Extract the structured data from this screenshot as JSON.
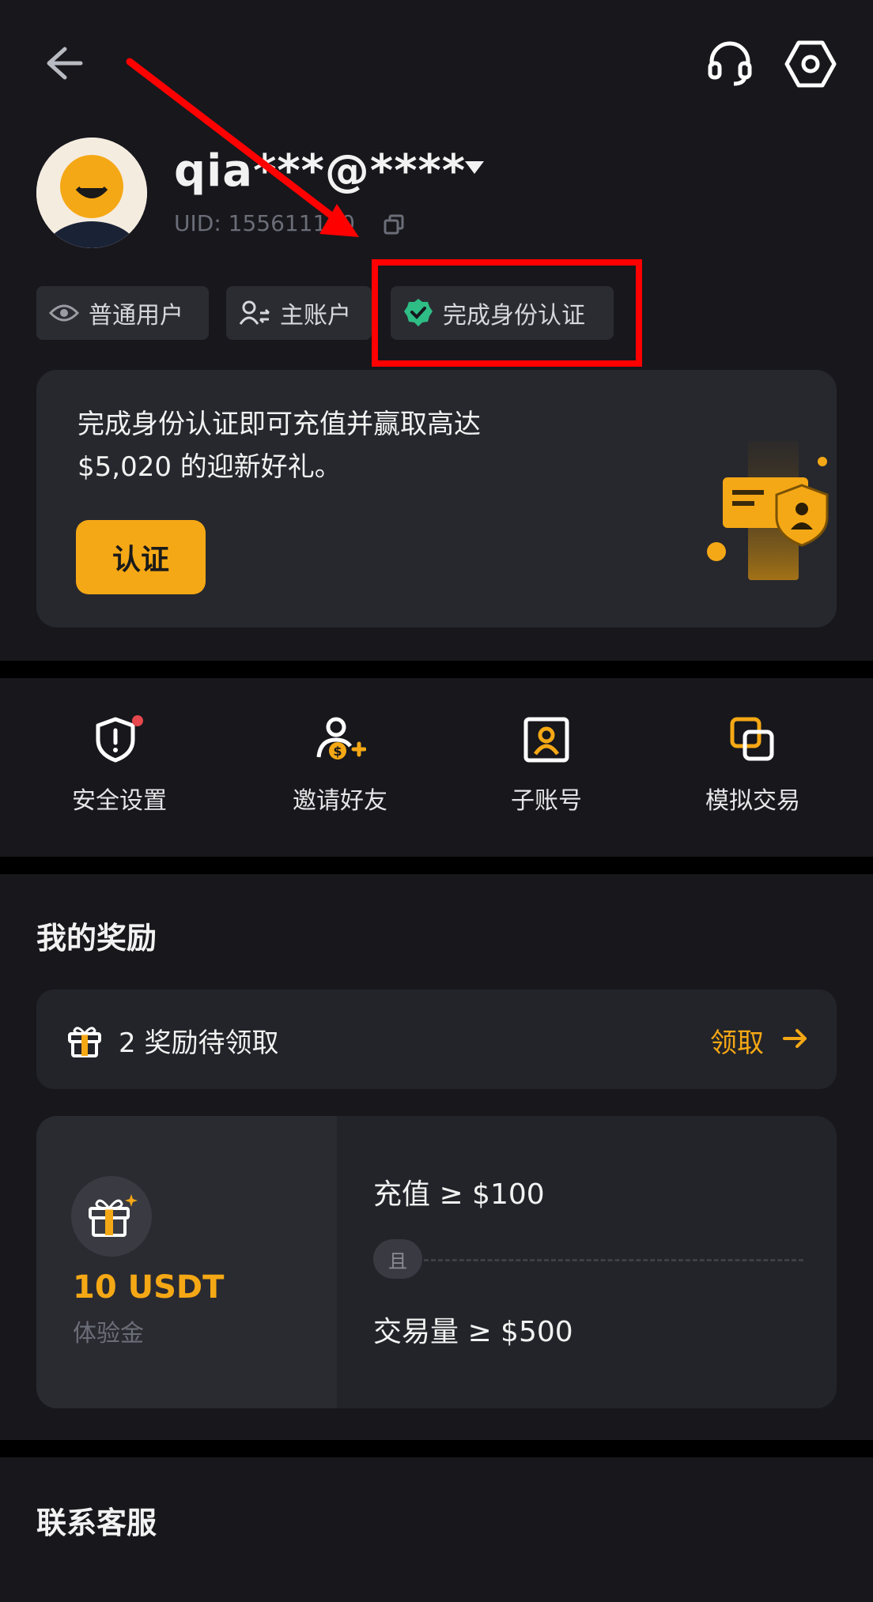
{
  "header": {
    "back_icon": "arrow-left-icon",
    "support_icon": "headset-icon",
    "settings_icon": "hexagon-gear-icon"
  },
  "profile": {
    "account_name": "qia***@****",
    "uid": "UID: 155611120",
    "avatar_icon": "smiley-avatar-icon"
  },
  "tags": {
    "regular_user": "普通用户",
    "main_account": "主账户",
    "kyc_done": "完成身份认证"
  },
  "kyc_card": {
    "line1": "完成身份认证即可充值并赢取高达",
    "line2": "$5,020 的迎新好礼。",
    "button_label": "认证"
  },
  "shortcuts": [
    {
      "label": "安全设置",
      "icon": "shield-alert-icon"
    },
    {
      "label": "邀请好友",
      "icon": "invite-friend-icon"
    },
    {
      "label": "子账号",
      "icon": "sub-account-icon"
    },
    {
      "label": "模拟交易",
      "icon": "demo-trading-icon"
    }
  ],
  "rewards": {
    "title": "我的奖励",
    "pending_text": "2 奖励待领取",
    "claim_label": "领取",
    "card": {
      "amount": "10 USDT",
      "desc": "体验金",
      "condition1": "充值 ≥ $100",
      "and_label": "且",
      "condition2": "交易量 ≥ $500"
    }
  },
  "contact": {
    "title": "联系客服"
  },
  "colors": {
    "background": "#17171c",
    "card": "#27282e",
    "accent": "#f5a815",
    "verified_green": "#2ebd85",
    "annotation_red": "#ff0000"
  }
}
